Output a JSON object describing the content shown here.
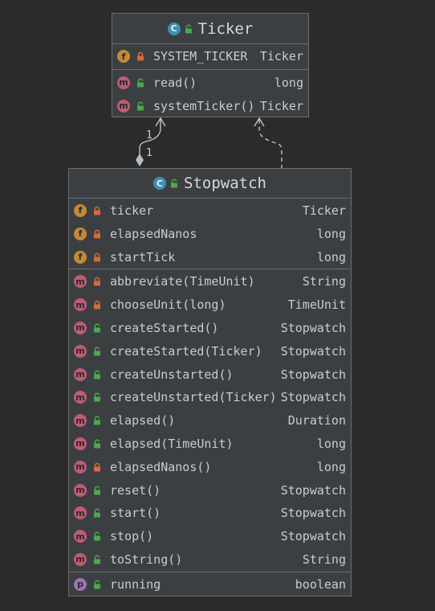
{
  "colors": {
    "background": "#2b2b2b",
    "box_fill": "#3c3f41",
    "border": "#6b6e70",
    "class_icon": "#3e8fb0",
    "field_icon": "#c38a35",
    "method_icon": "#c05a75",
    "property_icon": "#9a73b5",
    "private_lock": "#d56a3b",
    "public_lock": "#4ea84c"
  },
  "relationships": {
    "composition_multiplicity_top": "1",
    "composition_multiplicity_bottom": "1"
  },
  "ticker": {
    "badge": "C",
    "title": "Ticker",
    "fields": [
      {
        "badge": "f",
        "visibility": "private",
        "name": "SYSTEM_TICKER",
        "type": "Ticker"
      }
    ],
    "methods": [
      {
        "badge": "m",
        "visibility": "public",
        "name": "read()",
        "type": "long"
      },
      {
        "badge": "m",
        "visibility": "public",
        "name": "systemTicker()",
        "type": "Ticker"
      }
    ]
  },
  "stopwatch": {
    "badge": "C",
    "title": "Stopwatch",
    "fields": [
      {
        "badge": "f",
        "visibility": "private",
        "name": "ticker",
        "type": "Ticker"
      },
      {
        "badge": "f",
        "visibility": "private",
        "name": "elapsedNanos",
        "type": "long"
      },
      {
        "badge": "f",
        "visibility": "private",
        "name": "startTick",
        "type": "long"
      }
    ],
    "methods": [
      {
        "badge": "m",
        "visibility": "private",
        "name": "abbreviate(TimeUnit)",
        "type": "String"
      },
      {
        "badge": "m",
        "visibility": "private",
        "name": "chooseUnit(long)",
        "type": "TimeUnit"
      },
      {
        "badge": "m",
        "visibility": "public",
        "name": "createStarted()",
        "type": "Stopwatch"
      },
      {
        "badge": "m",
        "visibility": "public",
        "name": "createStarted(Ticker)",
        "type": "Stopwatch"
      },
      {
        "badge": "m",
        "visibility": "public",
        "name": "createUnstarted()",
        "type": "Stopwatch"
      },
      {
        "badge": "m",
        "visibility": "public",
        "name": "createUnstarted(Ticker)",
        "type": "Stopwatch"
      },
      {
        "badge": "m",
        "visibility": "public",
        "name": "elapsed()",
        "type": "Duration"
      },
      {
        "badge": "m",
        "visibility": "public",
        "name": "elapsed(TimeUnit)",
        "type": "long"
      },
      {
        "badge": "m",
        "visibility": "private",
        "name": "elapsedNanos()",
        "type": "long"
      },
      {
        "badge": "m",
        "visibility": "public",
        "name": "reset()",
        "type": "Stopwatch"
      },
      {
        "badge": "m",
        "visibility": "public",
        "name": "start()",
        "type": "Stopwatch"
      },
      {
        "badge": "m",
        "visibility": "public",
        "name": "stop()",
        "type": "Stopwatch"
      },
      {
        "badge": "m",
        "visibility": "public",
        "name": "toString()",
        "type": "String"
      }
    ],
    "properties": [
      {
        "badge": "p",
        "visibility": "public",
        "name": "running",
        "type": "boolean"
      }
    ]
  }
}
